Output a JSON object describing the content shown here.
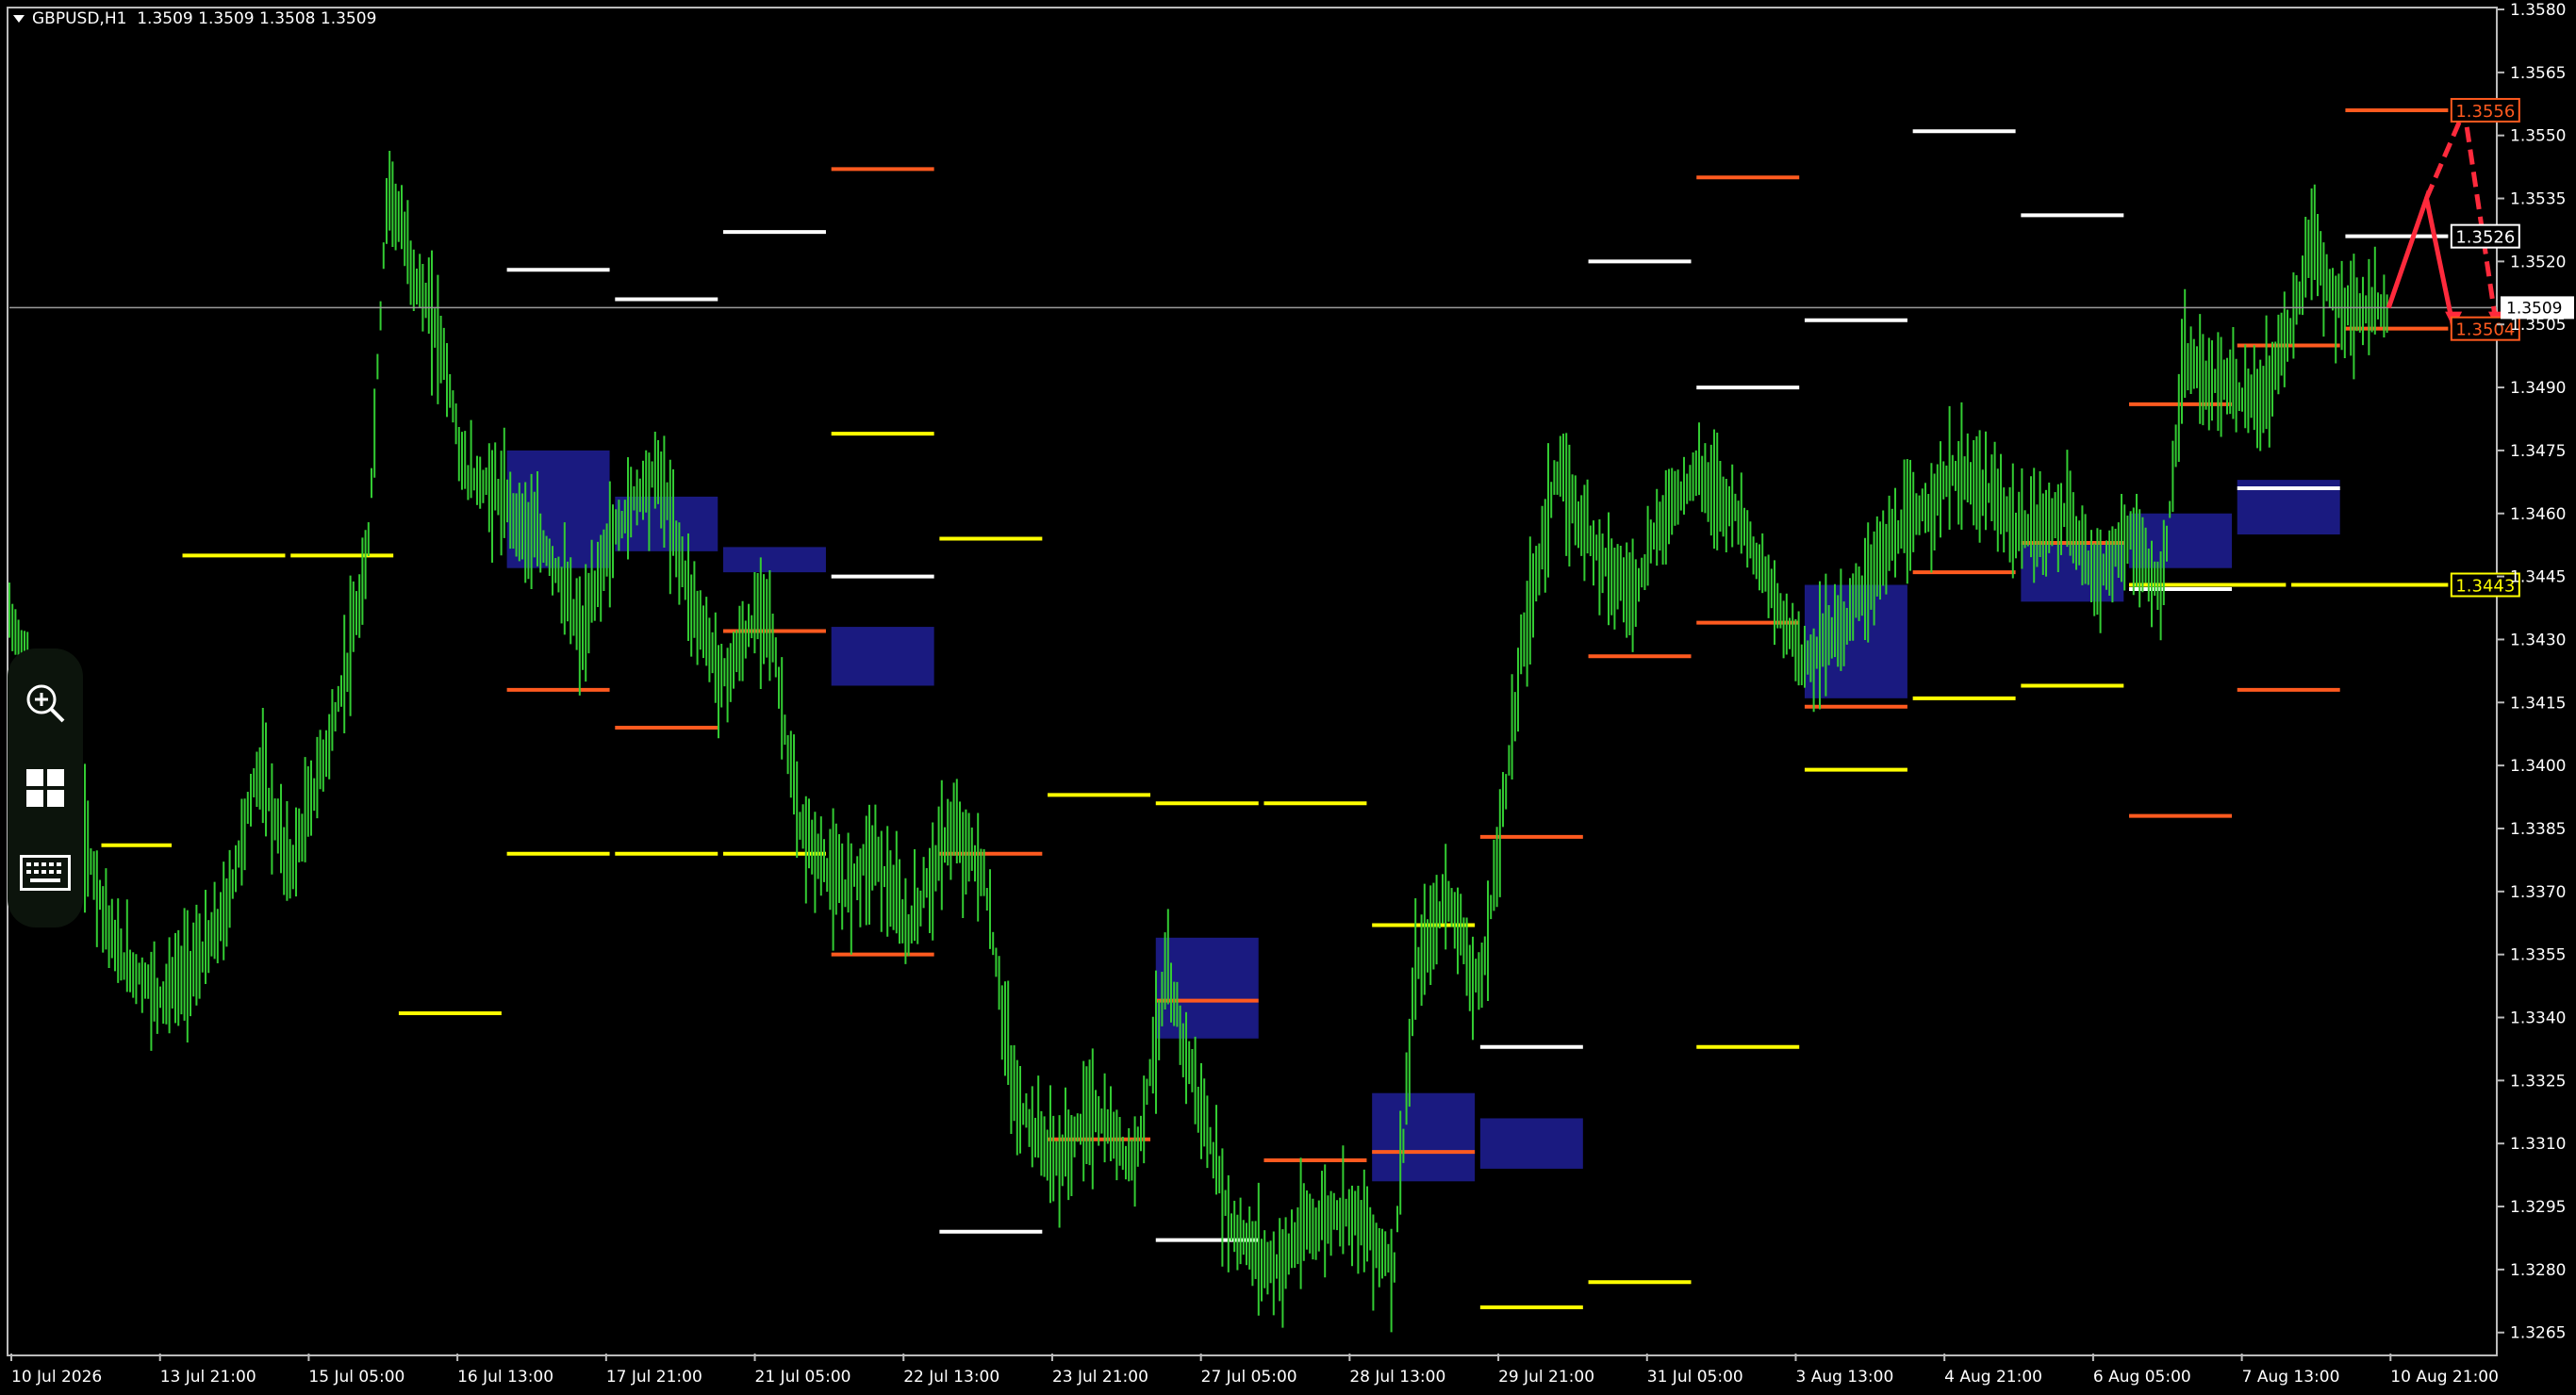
{
  "header": {
    "symbol": "GBPUSD,H1",
    "ohlc": "1.3509 1.3509 1.3508 1.3509"
  },
  "toolbar": [
    "zoom-in",
    "layout-grid",
    "keyboard"
  ],
  "colors": {
    "background": "#000000",
    "candles": "#33cc33",
    "yellow": "#ffff00",
    "orange": "#ff5a1f",
    "white": "#ffffff",
    "zone": "#1a1a80",
    "arrow": "#ff2a3c"
  },
  "chart_data": {
    "type": "line",
    "title": "GBPUSD,H1",
    "ylim": [
      1.326,
      1.358
    ],
    "y_ticks": [
      "1.3580",
      "1.3565",
      "1.3550",
      "1.3535",
      "1.3520",
      "1.3505",
      "1.3490",
      "1.3475",
      "1.3460",
      "1.3445",
      "1.3430",
      "1.3415",
      "1.3400",
      "1.3385",
      "1.3370",
      "1.3355",
      "1.3340",
      "1.3325",
      "1.3310",
      "1.3295",
      "1.3280",
      "1.3265"
    ],
    "x_labels": [
      "10 Jul 2026",
      "13 Jul 21:00",
      "15 Jul 05:00",
      "16 Jul 13:00",
      "17 Jul 21:00",
      "21 Jul 05:00",
      "22 Jul 13:00",
      "23 Jul 21:00",
      "27 Jul 05:00",
      "28 Jul 13:00",
      "29 Jul 21:00",
      "31 Jul 05:00",
      "3 Aug 13:00",
      "4 Aug 21:00",
      "6 Aug 05:00",
      "7 Aug 13:00",
      "10 Aug 21:00"
    ],
    "price_line": 1.3509,
    "price_label": "1.3509",
    "price_path": [
      [
        0,
        1.3435
      ],
      [
        0.5,
        1.34
      ],
      [
        1,
        1.3355
      ],
      [
        1.4,
        1.3345
      ],
      [
        1.8,
        1.3355
      ],
      [
        2,
        1.3365
      ],
      [
        2.3,
        1.34
      ],
      [
        2.6,
        1.3375
      ],
      [
        3,
        1.341
      ],
      [
        3.3,
        1.3445
      ],
      [
        3.5,
        1.354
      ],
      [
        3.7,
        1.352
      ],
      [
        4,
        1.35
      ],
      [
        4.2,
        1.347
      ],
      [
        4.5,
        1.3465
      ],
      [
        5,
        1.345
      ],
      [
        5.3,
        1.343
      ],
      [
        5.5,
        1.345
      ],
      [
        5.8,
        1.3465
      ],
      [
        6,
        1.347
      ],
      [
        6.3,
        1.344
      ],
      [
        6.6,
        1.342
      ],
      [
        7,
        1.344
      ],
      [
        7.3,
        1.3385
      ],
      [
        7.7,
        1.337
      ],
      [
        8,
        1.338
      ],
      [
        8.3,
        1.336
      ],
      [
        8.7,
        1.3385
      ],
      [
        9,
        1.3375
      ],
      [
        9.3,
        1.332
      ],
      [
        9.7,
        1.3305
      ],
      [
        10,
        1.3318
      ],
      [
        10.4,
        1.3305
      ],
      [
        10.7,
        1.335
      ],
      [
        11,
        1.332
      ],
      [
        11.3,
        1.329
      ],
      [
        11.7,
        1.328
      ],
      [
        12,
        1.329
      ],
      [
        12.4,
        1.3295
      ],
      [
        12.8,
        1.328
      ],
      [
        13,
        1.335
      ],
      [
        13.3,
        1.337
      ],
      [
        13.6,
        1.3345
      ],
      [
        14,
        1.343
      ],
      [
        14.3,
        1.347
      ],
      [
        14.6,
        1.3455
      ],
      [
        15,
        1.344
      ],
      [
        15.3,
        1.346
      ],
      [
        15.6,
        1.347
      ],
      [
        16,
        1.346
      ],
      [
        16.3,
        1.344
      ],
      [
        16.6,
        1.3425
      ],
      [
        17,
        1.3435
      ],
      [
        17.3,
        1.345
      ],
      [
        17.6,
        1.3458
      ],
      [
        18,
        1.347
      ],
      [
        18.3,
        1.3465
      ],
      [
        18.6,
        1.3455
      ],
      [
        19,
        1.346
      ],
      [
        19.3,
        1.3445
      ],
      [
        19.6,
        1.3455
      ],
      [
        19.9,
        1.344
      ],
      [
        20.1,
        1.3495
      ],
      [
        20.5,
        1.349
      ],
      [
        20.8,
        1.3485
      ],
      [
        21.1,
        1.3505
      ],
      [
        21.3,
        1.3525
      ],
      [
        21.5,
        1.351
      ],
      [
        21.8,
        1.3508
      ],
      [
        22,
        1.3509
      ]
    ],
    "levels": [
      {
        "color": "yellow",
        "price": 1.3381,
        "x0": 0.85,
        "x1": 1.5
      },
      {
        "color": "yellow",
        "price": 1.345,
        "x0": 1.6,
        "x1": 2.55
      },
      {
        "color": "yellow",
        "price": 1.345,
        "x0": 2.6,
        "x1": 3.55
      },
      {
        "color": "yellow",
        "price": 1.3341,
        "x0": 3.6,
        "x1": 4.55
      },
      {
        "color": "yellow",
        "price": 1.3379,
        "x0": 4.6,
        "x1": 5.55
      },
      {
        "color": "yellow",
        "price": 1.3379,
        "x0": 5.6,
        "x1": 6.55
      },
      {
        "color": "yellow",
        "price": 1.3379,
        "x0": 6.6,
        "x1": 7.55
      },
      {
        "color": "yellow",
        "price": 1.3479,
        "x0": 7.6,
        "x1": 8.55
      },
      {
        "color": "yellow",
        "price": 1.3454,
        "x0": 8.6,
        "x1": 9.55
      },
      {
        "color": "yellow",
        "price": 1.3393,
        "x0": 9.6,
        "x1": 10.55
      },
      {
        "color": "yellow",
        "price": 1.3391,
        "x0": 10.6,
        "x1": 11.55
      },
      {
        "color": "yellow",
        "price": 1.3391,
        "x0": 11.6,
        "x1": 12.55
      },
      {
        "color": "yellow",
        "price": 1.3362,
        "x0": 12.6,
        "x1": 13.55
      },
      {
        "color": "yellow",
        "price": 1.3271,
        "x0": 13.6,
        "x1": 14.55
      },
      {
        "color": "yellow",
        "price": 1.3277,
        "x0": 14.6,
        "x1": 15.55
      },
      {
        "color": "yellow",
        "price": 1.3333,
        "x0": 15.6,
        "x1": 16.55
      },
      {
        "color": "yellow",
        "price": 1.3399,
        "x0": 16.6,
        "x1": 17.55
      },
      {
        "color": "yellow",
        "price": 1.3416,
        "x0": 17.6,
        "x1": 18.55
      },
      {
        "color": "yellow",
        "price": 1.3419,
        "x0": 18.6,
        "x1": 19.55
      },
      {
        "color": "yellow",
        "price": 1.3443,
        "x0": 19.6,
        "x1": 21.05
      },
      {
        "color": "yellow",
        "price": 1.3443,
        "x0": 21.1,
        "x1": 22.55
      },
      {
        "color": "orange",
        "price": 1.3418,
        "x0": 4.6,
        "x1": 5.55
      },
      {
        "color": "orange",
        "price": 1.3409,
        "x0": 5.6,
        "x1": 6.55
      },
      {
        "color": "orange",
        "price": 1.3432,
        "x0": 6.6,
        "x1": 7.55
      },
      {
        "color": "orange",
        "price": 1.3355,
        "x0": 7.6,
        "x1": 8.55
      },
      {
        "color": "orange",
        "price": 1.3542,
        "x0": 7.6,
        "x1": 8.55
      },
      {
        "color": "orange",
        "price": 1.3379,
        "x0": 8.6,
        "x1": 9.55
      },
      {
        "color": "orange",
        "price": 1.3311,
        "x0": 9.6,
        "x1": 10.55
      },
      {
        "color": "orange",
        "price": 1.3344,
        "x0": 10.6,
        "x1": 11.55
      },
      {
        "color": "orange",
        "price": 1.3306,
        "x0": 11.6,
        "x1": 12.55
      },
      {
        "color": "orange",
        "price": 1.3308,
        "x0": 12.6,
        "x1": 13.55
      },
      {
        "color": "orange",
        "price": 1.3383,
        "x0": 13.6,
        "x1": 14.55
      },
      {
        "color": "orange",
        "price": 1.3426,
        "x0": 14.6,
        "x1": 15.55
      },
      {
        "color": "orange",
        "price": 1.354,
        "x0": 15.6,
        "x1": 16.55
      },
      {
        "color": "orange",
        "price": 1.3434,
        "x0": 15.6,
        "x1": 16.55
      },
      {
        "color": "orange",
        "price": 1.3414,
        "x0": 16.6,
        "x1": 17.55
      },
      {
        "color": "orange",
        "price": 1.3446,
        "x0": 17.6,
        "x1": 18.55
      },
      {
        "color": "orange",
        "price": 1.3453,
        "x0": 18.6,
        "x1": 19.55
      },
      {
        "color": "orange",
        "price": 1.3388,
        "x0": 19.6,
        "x1": 20.55
      },
      {
        "color": "orange",
        "price": 1.3486,
        "x0": 19.6,
        "x1": 20.55
      },
      {
        "color": "orange",
        "price": 1.3418,
        "x0": 20.6,
        "x1": 21.55
      },
      {
        "color": "orange",
        "price": 1.35,
        "x0": 20.6,
        "x1": 21.55
      },
      {
        "color": "orange",
        "price": 1.3504,
        "x0": 21.6,
        "x1": 22.55
      },
      {
        "color": "orange",
        "price": 1.3556,
        "x0": 21.6,
        "x1": 22.55
      },
      {
        "color": "white",
        "price": 1.3518,
        "x0": 4.6,
        "x1": 5.55
      },
      {
        "color": "white",
        "price": 1.3511,
        "x0": 5.6,
        "x1": 6.55
      },
      {
        "color": "white",
        "price": 1.3527,
        "x0": 6.6,
        "x1": 7.55
      },
      {
        "color": "white",
        "price": 1.3445,
        "x0": 7.6,
        "x1": 8.55
      },
      {
        "color": "white",
        "price": 1.3289,
        "x0": 8.6,
        "x1": 9.55
      },
      {
        "color": "white",
        "price": 1.3287,
        "x0": 10.6,
        "x1": 11.55
      },
      {
        "color": "white",
        "price": 1.3333,
        "x0": 13.6,
        "x1": 14.55
      },
      {
        "color": "white",
        "price": 1.352,
        "x0": 14.6,
        "x1": 15.55
      },
      {
        "color": "white",
        "price": 1.349,
        "x0": 15.6,
        "x1": 16.55
      },
      {
        "color": "white",
        "price": 1.3506,
        "x0": 16.6,
        "x1": 17.55
      },
      {
        "color": "white",
        "price": 1.3551,
        "x0": 17.6,
        "x1": 18.55
      },
      {
        "color": "white",
        "price": 1.3531,
        "x0": 18.6,
        "x1": 19.55
      },
      {
        "color": "white",
        "price": 1.3442,
        "x0": 19.6,
        "x1": 20.55
      },
      {
        "color": "white",
        "price": 1.3466,
        "x0": 20.6,
        "x1": 21.55
      },
      {
        "color": "white",
        "price": 1.3526,
        "x0": 21.6,
        "x1": 22.55
      }
    ],
    "zones": [
      {
        "x0": 4.6,
        "x1": 5.55,
        "top": 1.3475,
        "bottom": 1.3447
      },
      {
        "x0": 5.6,
        "x1": 6.55,
        "top": 1.3464,
        "bottom": 1.3451
      },
      {
        "x0": 6.6,
        "x1": 7.55,
        "top": 1.3452,
        "bottom": 1.3446
      },
      {
        "x0": 7.6,
        "x1": 8.55,
        "top": 1.3433,
        "bottom": 1.3419
      },
      {
        "x0": 10.6,
        "x1": 11.55,
        "top": 1.3359,
        "bottom": 1.3335
      },
      {
        "x0": 12.6,
        "x1": 13.55,
        "top": 1.3322,
        "bottom": 1.3301
      },
      {
        "x0": 13.6,
        "x1": 14.55,
        "top": 1.3316,
        "bottom": 1.3304
      },
      {
        "x0": 16.6,
        "x1": 17.55,
        "top": 1.3443,
        "bottom": 1.3416
      },
      {
        "x0": 18.6,
        "x1": 19.55,
        "top": 1.3453,
        "bottom": 1.3439
      },
      {
        "x0": 19.6,
        "x1": 20.55,
        "top": 1.346,
        "bottom": 1.3447
      },
      {
        "x0": 20.6,
        "x1": 21.55,
        "top": 1.3468,
        "bottom": 1.3455
      }
    ],
    "level_labels": [
      {
        "text": "1.3556",
        "price": 1.3556,
        "color": "orange"
      },
      {
        "text": "1.3526",
        "price": 1.3526,
        "color": "white"
      },
      {
        "text": "1.3504",
        "price": 1.3504,
        "color": "orange"
      },
      {
        "text": "1.3443",
        "price": 1.3443,
        "color": "yellow"
      }
    ],
    "arrows": [
      {
        "style": "solid",
        "from": [
          22.0,
          1.3509
        ],
        "via": [
          22.35,
          1.3535
        ],
        "to": [
          22.6,
          1.3504
        ]
      },
      {
        "style": "dashed",
        "from": [
          22.35,
          1.3535
        ],
        "via": [
          22.7,
          1.3556
        ],
        "to": [
          23.0,
          1.3504
        ]
      }
    ],
    "grid": false
  }
}
